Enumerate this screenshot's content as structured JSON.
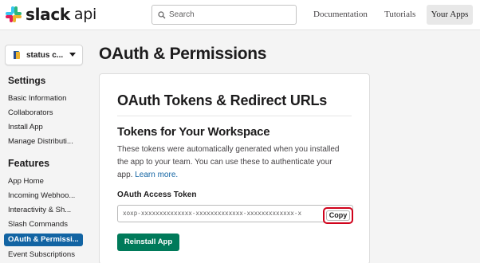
{
  "header": {
    "logo_text": "slack",
    "logo_sub": "api",
    "search_placeholder": "Search",
    "nav": [
      "Documentation",
      "Tutorials",
      "Your Apps"
    ]
  },
  "sidebar": {
    "app_name": "status c...",
    "settings_heading": "Settings",
    "settings_items": [
      "Basic Information",
      "Collaborators",
      "Install App",
      "Manage Distributi..."
    ],
    "features_heading": "Features",
    "features_items": [
      "App Home",
      "Incoming Webhoo...",
      "Interactivity & Sh...",
      "Slash Commands",
      "OAuth & Permissi...",
      "Event Subscriptions"
    ],
    "active_item": "OAuth & Permissi..."
  },
  "main": {
    "page_title": "OAuth & Permissions",
    "card_title": "OAuth Tokens & Redirect URLs",
    "section_title": "Tokens for Your Workspace",
    "description_line1": "These tokens were automatically generated when you installed",
    "description_line2": "the app to your team. You can use these to authenticate your",
    "description_line3": "app.",
    "learn_more": "Learn more.",
    "token_label": "OAuth Access Token",
    "token_value": "xoxp-xxxxxxxxxxxxxx-xxxxxxxxxxxxx-xxxxxxxxxxxxx-x",
    "copy_label": "Copy",
    "reinstall_label": "Reinstall App"
  },
  "colors": {
    "accent_blue": "#1264a3",
    "reinstall_green": "#007a5a",
    "highlight_red": "#d0021b"
  }
}
